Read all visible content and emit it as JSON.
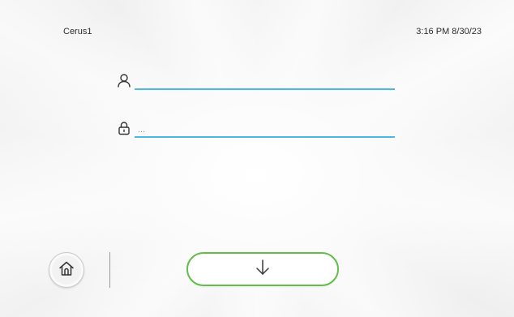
{
  "header": {
    "device_name": "Cerus1",
    "datetime": "3:16 PM 8/30/23"
  },
  "login": {
    "username": {
      "icon": "user-icon",
      "value": ""
    },
    "password": {
      "icon": "lock-icon",
      "value": "",
      "placeholder": "..."
    }
  },
  "footer": {
    "home_icon": "home-icon",
    "submit_icon": "arrow-down-icon",
    "accent_color": "#63bd49"
  },
  "colors": {
    "field_underline": "#4ab8e0",
    "submit_border": "#63bd49"
  }
}
